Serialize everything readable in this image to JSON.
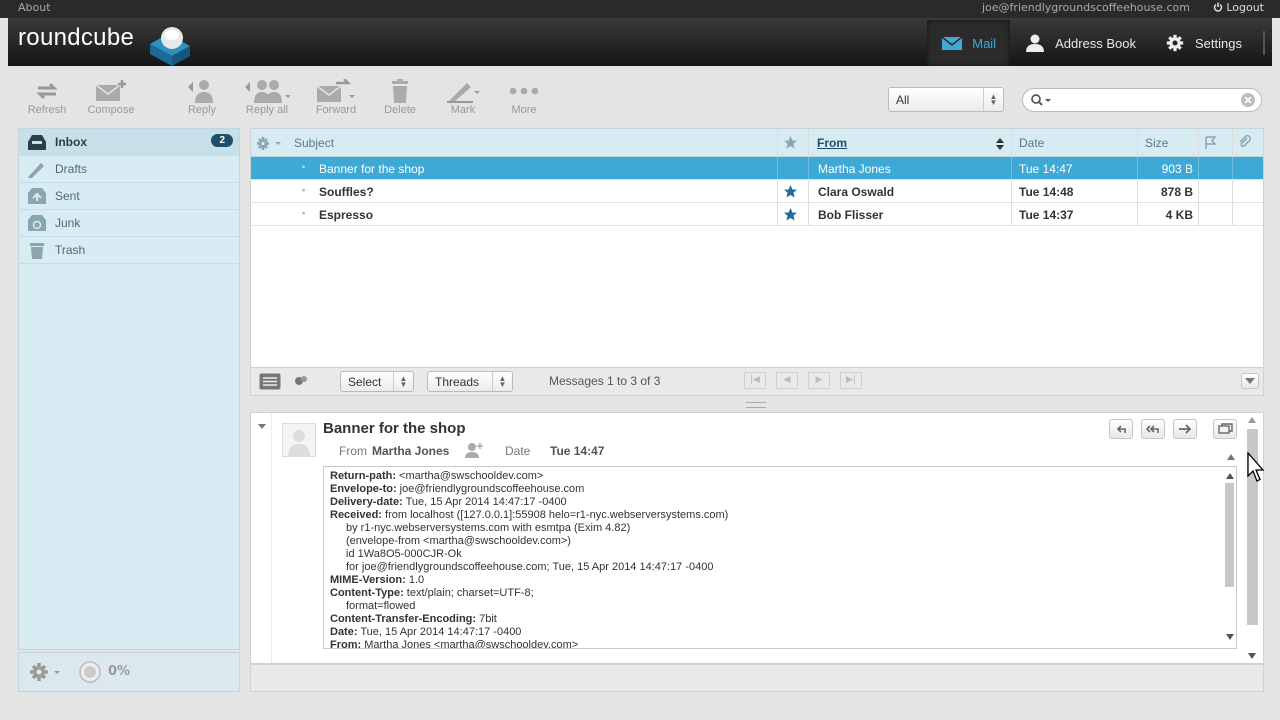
{
  "topbar": {
    "about": "About",
    "user_email": "joe@friendlygroundscoffeehouse.com",
    "logout": "Logout"
  },
  "logo": {
    "text": "roundcube"
  },
  "tasks": [
    {
      "label": "Mail",
      "icon": "mail-icon",
      "selected": true
    },
    {
      "label": "Address Book",
      "icon": "user-icon",
      "selected": false
    },
    {
      "label": "Settings",
      "icon": "gear-icon",
      "selected": false
    }
  ],
  "toolbar": {
    "refresh": "Refresh",
    "compose": "Compose",
    "reply": "Reply",
    "reply_all": "Reply all",
    "forward": "Forward",
    "delete": "Delete",
    "mark": "Mark",
    "more": "More"
  },
  "filter": {
    "value": "All"
  },
  "folders": [
    {
      "label": "Inbox",
      "icon": "inbox-icon",
      "unread": "2",
      "selected": true
    },
    {
      "label": "Drafts",
      "icon": "pencil-icon",
      "unread": "",
      "selected": false
    },
    {
      "label": "Sent",
      "icon": "sent-icon",
      "unread": "",
      "selected": false
    },
    {
      "label": "Junk",
      "icon": "junk-icon",
      "unread": "",
      "selected": false
    },
    {
      "label": "Trash",
      "icon": "trash-icon",
      "unread": "",
      "selected": false
    }
  ],
  "quota": {
    "value": "0%"
  },
  "list": {
    "columns": {
      "subject": "Subject",
      "from": "From",
      "date": "Date",
      "size": "Size"
    },
    "rows": [
      {
        "subject": "Banner for the shop",
        "from": "Martha Jones",
        "date": "Tue 14:47",
        "size": "903 B",
        "flagged": false,
        "unread": false,
        "selected": true
      },
      {
        "subject": "Souffles?",
        "from": "Clara Oswald",
        "date": "Tue 14:48",
        "size": "878 B",
        "flagged": true,
        "unread": true,
        "selected": false
      },
      {
        "subject": "Espresso",
        "from": "Bob Flisser",
        "date": "Tue 14:37",
        "size": "4 KB",
        "flagged": true,
        "unread": true,
        "selected": false
      }
    ],
    "footer": {
      "select": "Select",
      "threads": "Threads",
      "count_text": "Messages 1 to 3 of 3"
    }
  },
  "preview": {
    "subject": "Banner for the shop",
    "from_label": "From",
    "from": "Martha Jones",
    "date_label": "Date",
    "date": "Tue 14:47",
    "headers": [
      {
        "key": "Return-path:",
        "value": " <martha@swschooldev.com>",
        "indent": false
      },
      {
        "key": "Envelope-to:",
        "value": " joe@friendlygroundscoffeehouse.com",
        "indent": false
      },
      {
        "key": "Delivery-date:",
        "value": " Tue, 15 Apr 2014 14:47:17 -0400",
        "indent": false
      },
      {
        "key": "Received:",
        "value": " from localhost ([127.0.0.1]:55908 helo=r1-nyc.webserversystems.com)",
        "indent": false
      },
      {
        "key": "",
        "value": "by r1-nyc.webserversystems.com with esmtpa (Exim 4.82)",
        "indent": true
      },
      {
        "key": "",
        "value": "(envelope-from <martha@swschooldev.com>)",
        "indent": true
      },
      {
        "key": "",
        "value": "id 1Wa8O5-000CJR-Ok",
        "indent": true
      },
      {
        "key": "",
        "value": "for joe@friendlygroundscoffeehouse.com; Tue, 15 Apr 2014 14:47:17 -0400",
        "indent": true
      },
      {
        "key": "MIME-Version:",
        "value": " 1.0",
        "indent": false
      },
      {
        "key": "Content-Type:",
        "value": " text/plain; charset=UTF-8;",
        "indent": false
      },
      {
        "key": "",
        "value": "format=flowed",
        "indent": true
      },
      {
        "key": "Content-Transfer-Encoding:",
        "value": " 7bit",
        "indent": false
      },
      {
        "key": "Date:",
        "value": " Tue, 15 Apr 2014 14:47:17 -0400",
        "indent": false
      },
      {
        "key": "From:",
        "value": " Martha Jones <martha@swschooldev.com>",
        "indent": false
      }
    ]
  },
  "colors": {
    "accent": "#3fa9d6",
    "badge": "#1e4f6a",
    "panel": "#d9ecf4"
  }
}
